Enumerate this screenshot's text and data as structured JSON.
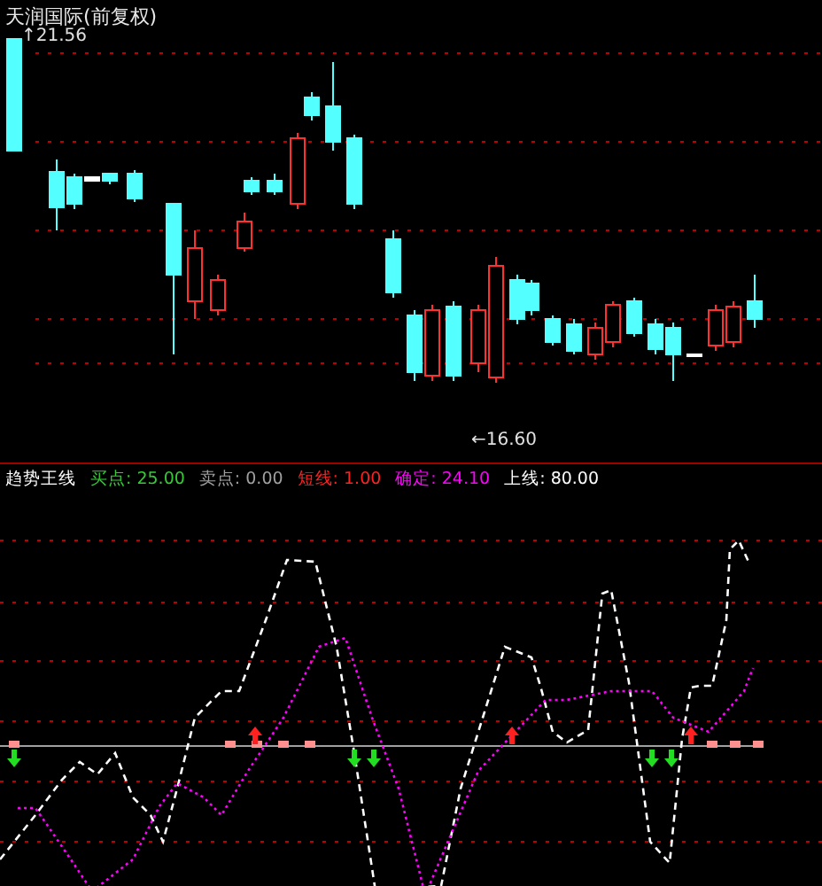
{
  "price_chart": {
    "title": "天润国际(前复权)",
    "high_label": "↑21.56",
    "low_label": "←16.60"
  },
  "indicator": {
    "name": "趋势王线",
    "values": [
      {
        "label": "买点: 25.00",
        "color": "#33cc33"
      },
      {
        "label": "卖点: 0.00",
        "color": "#a0a0a0"
      },
      {
        "label": "短线: 1.00",
        "color": "#ff2020"
      },
      {
        "label": "确定: 24.10",
        "color": "#ff00ff"
      },
      {
        "label": "上线: 80.00",
        "color": "#ffffff"
      }
    ]
  }
}
